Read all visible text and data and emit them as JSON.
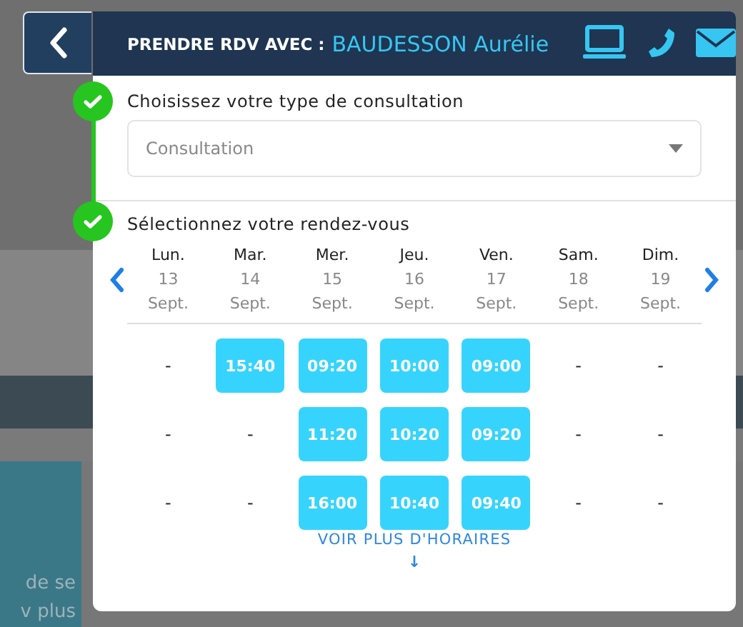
{
  "background": {
    "texts": [
      "de se",
      "v  plus"
    ]
  },
  "header": {
    "title": "PRENDRE RDV AVEC :",
    "name": "BAUDESSON Aurélie"
  },
  "steps": [
    {
      "label": "Choisissez votre type de consultation",
      "done": true
    },
    {
      "label": "Sélectionnez votre rendez-vous",
      "done": true
    }
  ],
  "consultation_select": {
    "value": "Consultation"
  },
  "days": [
    {
      "day": "Lun.",
      "date": "13",
      "month": "Sept.",
      "slots": [
        {
          "kind": "none",
          "label": "-"
        },
        {
          "kind": "none",
          "label": "-"
        },
        {
          "kind": "none",
          "label": "-"
        }
      ]
    },
    {
      "day": "Mar.",
      "date": "14",
      "month": "Sept.",
      "slots": [
        {
          "kind": "time",
          "label": "15:40"
        },
        {
          "kind": "none",
          "label": "-"
        },
        {
          "kind": "none",
          "label": "-"
        }
      ]
    },
    {
      "day": "Mer.",
      "date": "15",
      "month": "Sept.",
      "slots": [
        {
          "kind": "time",
          "label": "09:20"
        },
        {
          "kind": "time",
          "label": "11:20"
        },
        {
          "kind": "time",
          "label": "16:00"
        }
      ]
    },
    {
      "day": "Jeu.",
      "date": "16",
      "month": "Sept.",
      "slots": [
        {
          "kind": "time",
          "label": "10:00"
        },
        {
          "kind": "time",
          "label": "10:20"
        },
        {
          "kind": "time",
          "label": "10:40"
        }
      ]
    },
    {
      "day": "Ven.",
      "date": "17",
      "month": "Sept.",
      "slots": [
        {
          "kind": "time",
          "label": "09:00"
        },
        {
          "kind": "time",
          "label": "09:20"
        },
        {
          "kind": "time",
          "label": "09:40"
        }
      ]
    },
    {
      "day": "Sam.",
      "date": "18",
      "month": "Sept.",
      "slots": [
        {
          "kind": "none",
          "label": "-"
        },
        {
          "kind": "none",
          "label": "-"
        },
        {
          "kind": "none",
          "label": "-"
        }
      ]
    },
    {
      "day": "Dim.",
      "date": "19",
      "month": "Sept.",
      "slots": [
        {
          "kind": "none",
          "label": "-"
        },
        {
          "kind": "none",
          "label": "-"
        },
        {
          "kind": "none",
          "label": "-"
        }
      ]
    }
  ],
  "more_link": {
    "label": "VOIR PLUS D'HORAIRES",
    "arrow": "↓"
  }
}
